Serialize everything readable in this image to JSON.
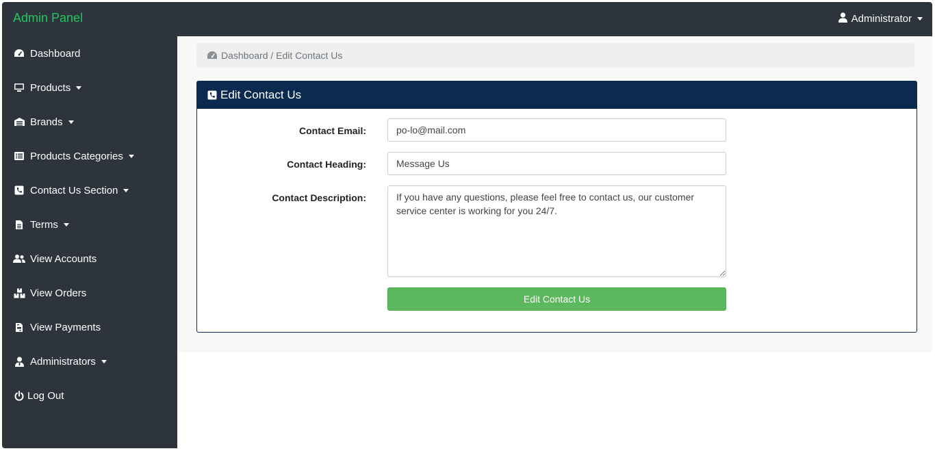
{
  "header": {
    "brand": "Admin Panel",
    "user_label": "Administrator"
  },
  "sidebar": {
    "items": [
      {
        "label": "Dashboard",
        "icon": "dashboard-icon",
        "has_caret": false
      },
      {
        "label": "Products",
        "icon": "monitor-icon",
        "has_caret": true
      },
      {
        "label": "Brands",
        "icon": "warehouse-icon",
        "has_caret": true
      },
      {
        "label": "Products Categories",
        "icon": "list-icon",
        "has_caret": true
      },
      {
        "label": "Contact Us Section",
        "icon": "phone-square-icon",
        "has_caret": true
      },
      {
        "label": "Terms",
        "icon": "file-icon",
        "has_caret": true
      },
      {
        "label": "View Accounts",
        "icon": "users-icon",
        "has_caret": false
      },
      {
        "label": "View Orders",
        "icon": "boxes-icon",
        "has_caret": false
      },
      {
        "label": "View Payments",
        "icon": "file-invoice-icon",
        "has_caret": false
      },
      {
        "label": "Administrators",
        "icon": "user-tie-icon",
        "has_caret": true
      },
      {
        "label": "Log Out",
        "icon": "power-icon",
        "has_caret": false
      }
    ]
  },
  "breadcrumb": {
    "text": "Dashboard / Edit Contact Us"
  },
  "card": {
    "title": "Edit Contact Us",
    "email_label": "Contact Email:",
    "email_value": "po-lo@mail.com",
    "heading_label": "Contact Heading:",
    "heading_value": "Message Us",
    "description_label": "Contact Description:",
    "description_value": "If you have any questions, please feel free to contact us, our customer service center is working for you 24/7.",
    "submit_label": "Edit Contact Us"
  },
  "colors": {
    "sidebar_bg": "#2d343c",
    "brand": "#22c55e",
    "card_header": "#0b2a4f",
    "submit": "#5cb85c"
  }
}
